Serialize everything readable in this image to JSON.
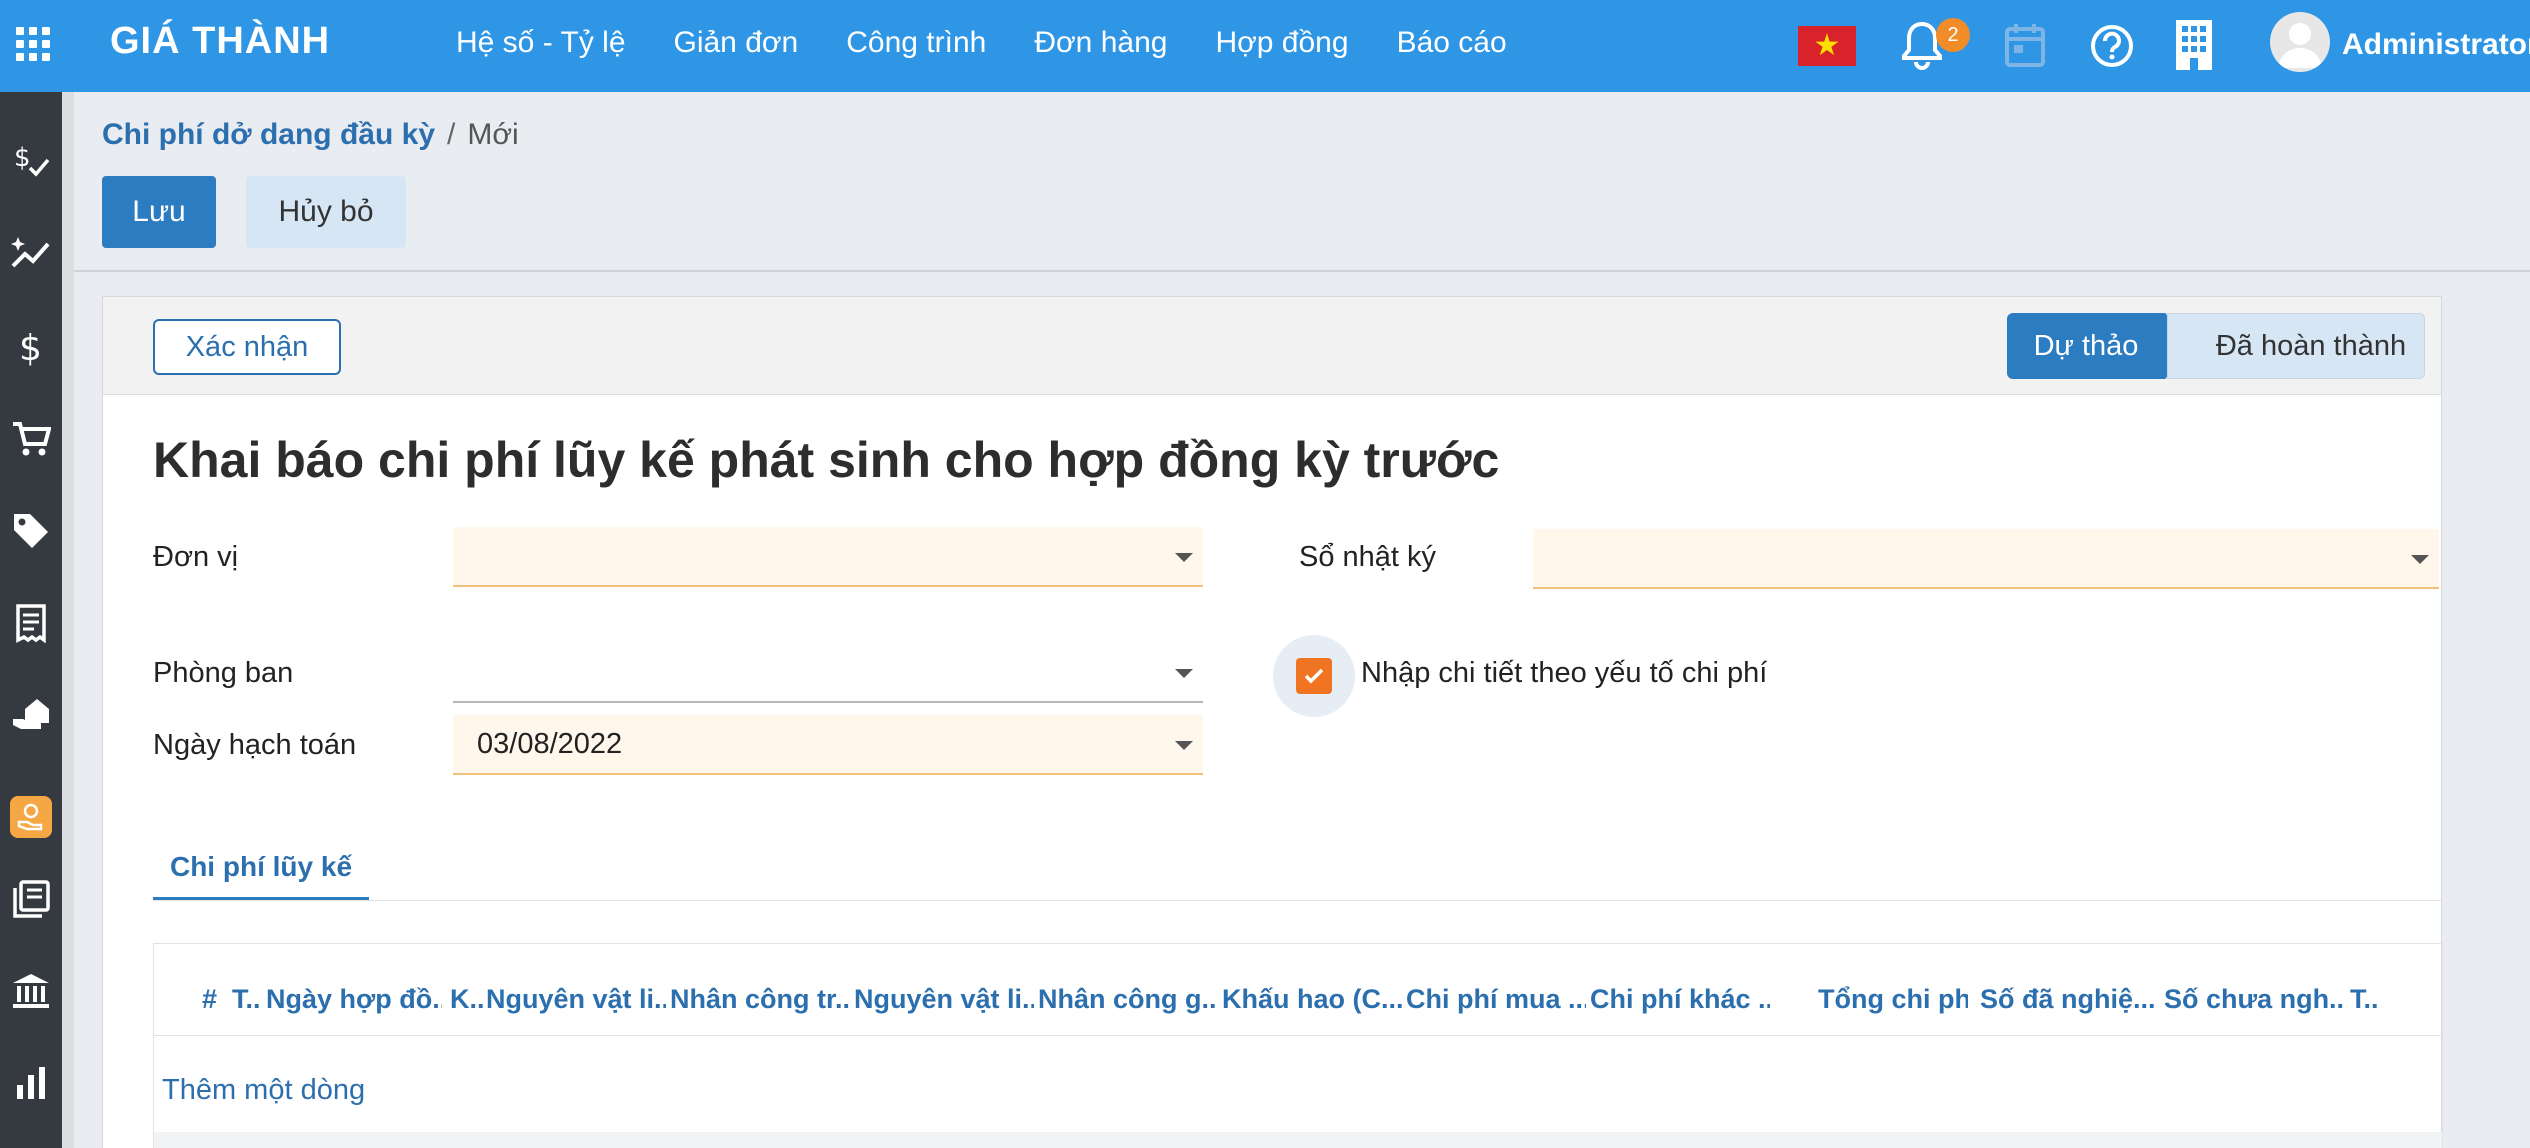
{
  "app": {
    "brand": "GIÁ THÀNH",
    "menu": [
      "Hệ số - Tỷ lệ",
      "Giản đơn",
      "Công trình",
      "Đơn hàng",
      "Hợp đồng",
      "Báo cáo"
    ],
    "notification_count": "2",
    "username": "Administrator",
    "accent_color": "#2f96e6"
  },
  "sidebar": {
    "icons": [
      "money-check-icon",
      "trend-up-icon",
      "dollar-icon",
      "cart-icon",
      "tag-icon",
      "receipt-icon",
      "hand-house-icon",
      "hand-coin-icon",
      "books-icon",
      "bank-icon",
      "bar-chart-icon"
    ]
  },
  "breadcrumb": {
    "parent": "Chi phí dở dang đầu kỳ",
    "separator": "/",
    "current": "Mới"
  },
  "toolbar": {
    "save_label": "Lưu",
    "discard_label": "Hủy bỏ"
  },
  "statusbar": {
    "confirm_label": "Xác nhận",
    "stages": [
      "Dự thảo",
      "Đã hoàn thành"
    ],
    "active_stage": "Dự thảo"
  },
  "form": {
    "title": "Khai báo chi phí lũy kế phát sinh cho hợp đồng kỳ trước",
    "unit_label": "Đơn vị",
    "unit_value": "",
    "journal_label": "Sổ nhật ký",
    "journal_value": "",
    "department_label": "Phòng ban",
    "department_value": "",
    "detail_checkbox_label": "Nhập chi tiết theo yếu tố chi phí",
    "detail_checked": true,
    "date_label": "Ngày hạch toán",
    "date_value": "03/08/2022"
  },
  "tabs": [
    "Chi phí lũy kế"
  ],
  "table": {
    "columns": [
      "#",
      "T..",
      "Ngày hợp đồ...",
      "K..",
      "Nguyên vật li...",
      "Nhân công tr...",
      "Nguyên vật li...",
      "Nhân công g...",
      "Khấu hao (C...",
      "Chi phí mua ...",
      "Chi phí khác ...",
      "Tổng chi phí",
      "Số đã nghiệ...",
      "Số chưa ngh...",
      "T.."
    ],
    "add_line": "Thêm một dòng"
  }
}
